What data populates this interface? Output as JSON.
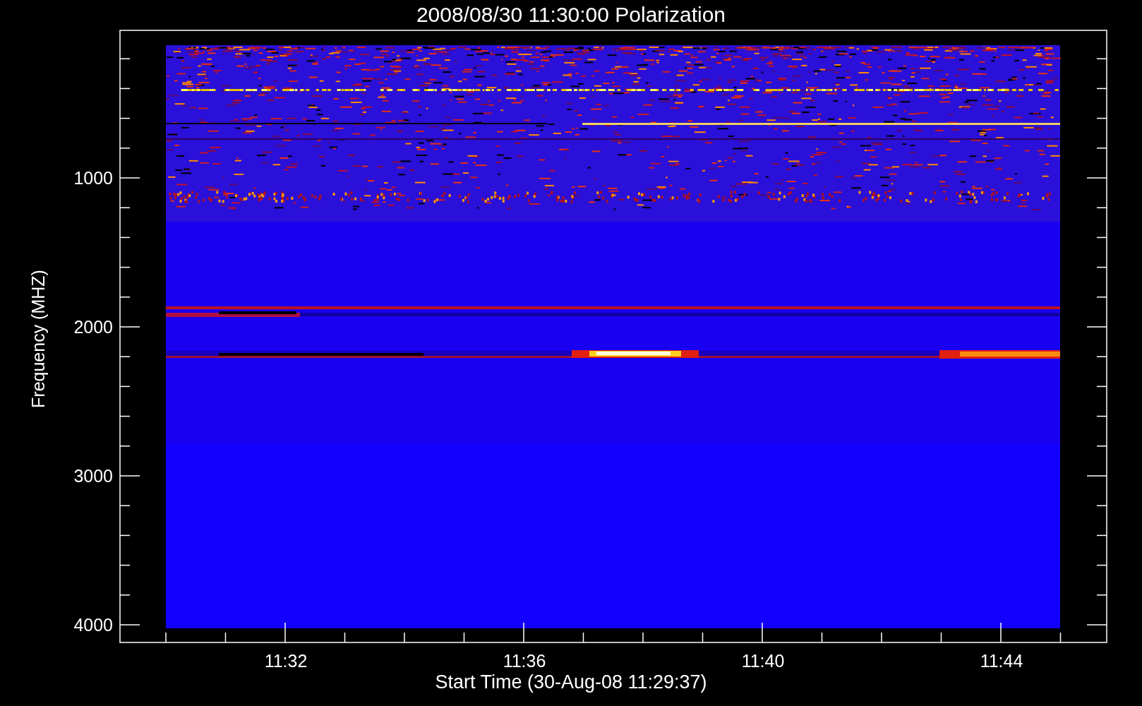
{
  "title": "2008/08/30 11:30:00 Polarization",
  "y_axis": {
    "label": "Frequency (MHZ)",
    "ticks": [
      "1000",
      "2000",
      "3000",
      "4000"
    ]
  },
  "x_axis": {
    "label": "Start Time (30-Aug-08 11:29:37)",
    "ticks": [
      "11:32",
      "11:36",
      "11:40",
      "11:44"
    ]
  }
}
